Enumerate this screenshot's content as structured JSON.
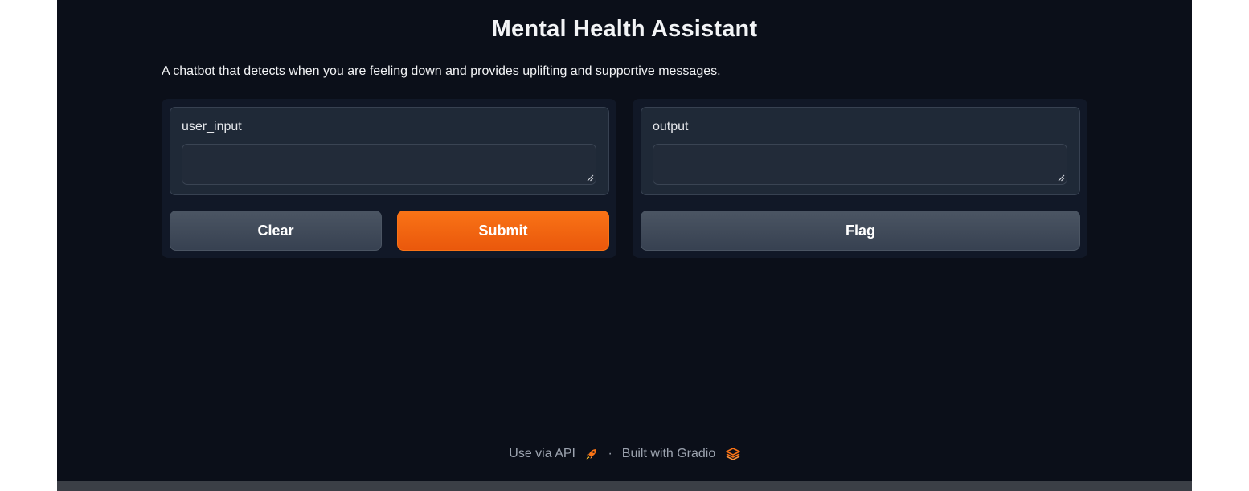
{
  "app": {
    "title": "Mental Health Assistant",
    "description": "A chatbot that detects when you are feeling down and provides uplifting and supportive messages."
  },
  "input_panel": {
    "label": "user_input",
    "value": "",
    "clear_label": "Clear",
    "submit_label": "Submit"
  },
  "output_panel": {
    "label": "output",
    "value": "",
    "flag_label": "Flag"
  },
  "footer": {
    "api_link": "Use via API",
    "separator": "·",
    "built_with": "Built with Gradio",
    "api_icon": "rocket-icon",
    "gradio_icon": "gradio-logo-icon"
  },
  "colors": {
    "background": "#0b0f19",
    "panel": "#111827",
    "block": "#1f2937",
    "accent": "#f97316",
    "secondary_button": "#4b5563"
  }
}
